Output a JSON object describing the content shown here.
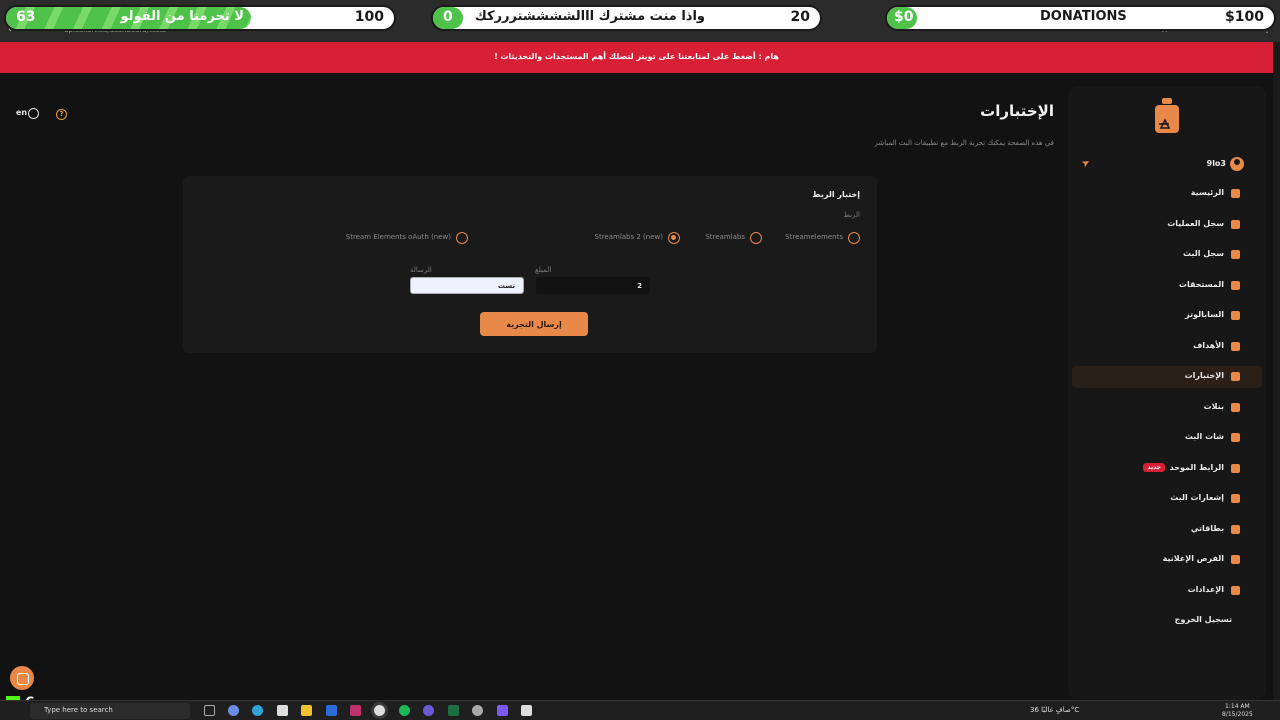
{
  "browser": {
    "url": "dp.sdkart.sa/dashboard/tests"
  },
  "overlay": {
    "follower_goal": {
      "current": "63",
      "target": "100",
      "text": "لا تحرمنا من الفولو",
      "progress": 0.63
    },
    "sub_goal": {
      "current": "0",
      "target": "20",
      "text": "واذا منت مشترك ااالششششتررركك",
      "progress": 0.0
    },
    "donation_goal": {
      "current": "$0",
      "target": "$100",
      "text": "DONATIONS",
      "progress": 0.0
    }
  },
  "alert": {
    "text": "! هام : أضغط على لمتابعتنا على تويتر لتصلك أهم المستجدات والتحديثات"
  },
  "topbar": {
    "lang": "en"
  },
  "page": {
    "title": "الإختبارات",
    "description": "في هذه الصفحة يمكنك تجربة الربط مع تطبيقات البث المباشر"
  },
  "card": {
    "title": "إختبار الربط",
    "connection_label": "الربط",
    "options": [
      "Streamelements",
      "Streamlabs",
      "Streamlabs 2 (new)",
      "Stream Elements oAuth (new)"
    ],
    "selected": "Streamlabs 2 (new)",
    "amount_label": "المبلغ",
    "amount_value": "2",
    "message_label": "الرسالة",
    "message_value": "تست",
    "send_label": "إرسال التجربة"
  },
  "sidebar": {
    "user": "9lo3",
    "items": [
      {
        "label": "الرئيسية"
      },
      {
        "label": "سجل العمليات"
      },
      {
        "label": "سجل البث"
      },
      {
        "label": "المستحقات"
      },
      {
        "label": "السابالوتز"
      },
      {
        "label": "الأهداف"
      },
      {
        "label": "الإختبارات",
        "active": true
      },
      {
        "label": "بنلات"
      },
      {
        "label": "شات البث"
      },
      {
        "label": "الرابط الموحد",
        "badge": "جديد"
      },
      {
        "label": "إشعارات البث"
      },
      {
        "label": "بطاقاتي"
      },
      {
        "label": "الفرص الإعلانية"
      },
      {
        "label": "الإعدادات"
      },
      {
        "label": "تسجيل الخروج"
      }
    ]
  },
  "taskbar": {
    "search_placeholder": "Type here to search",
    "weather": "صافٍ غالبًا  36°C",
    "time": "1:14 AM",
    "date": "8/15/2025",
    "kick_count": "6"
  },
  "colors": {
    "accent": "#e8894a",
    "alert": "#d71f36",
    "bg": "#121212",
    "panel": "#1a1a1a",
    "goal_green": "#4fc24a"
  }
}
